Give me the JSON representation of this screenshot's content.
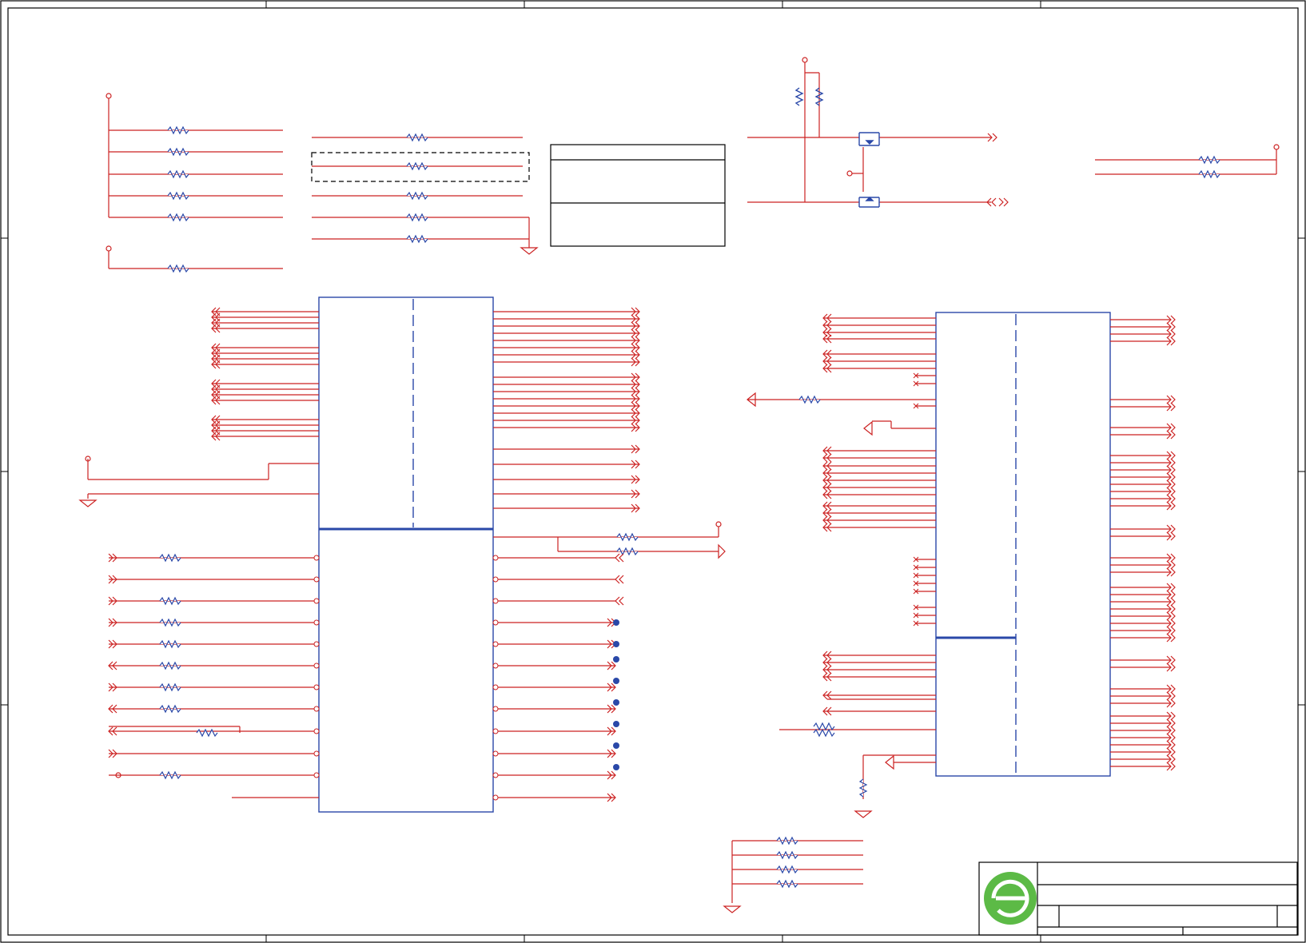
{
  "colors": {
    "border": "#000000",
    "wire": "#cc2222",
    "net": "#e05050",
    "body": "#2a48a8",
    "junction": "#2a48a8",
    "logo_green": "#5cba46",
    "logo_ring": "#ffffff"
  },
  "sheet": {
    "title": "",
    "page": "",
    "revision": ""
  },
  "title_block": {
    "logo": "company-logo-icon",
    "fields": [
      "",
      "",
      "",
      ""
    ]
  }
}
